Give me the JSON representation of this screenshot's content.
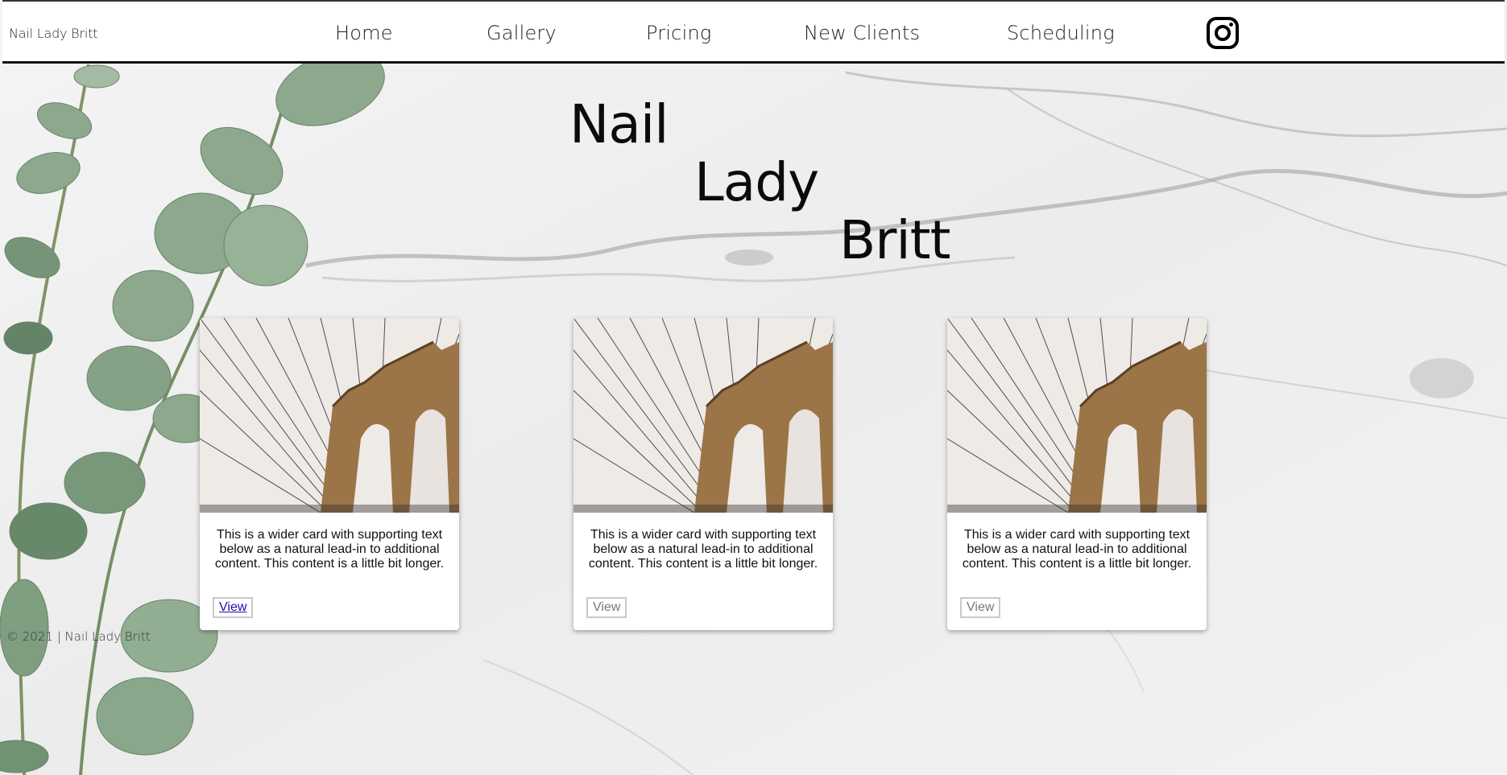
{
  "header": {
    "brand": "Nail Lady Britt",
    "nav": [
      "Home",
      "Gallery",
      "Pricing",
      "New Clients",
      "Scheduling"
    ],
    "social_icon": "instagram-icon"
  },
  "hero": {
    "words": [
      "Nail",
      "Lady",
      "Britt"
    ]
  },
  "cards": [
    {
      "text": "This is a wider card with supporting text below as a natural lead-in to additional content. This content is a little bit longer.",
      "button": "View",
      "image": "bridge-photo"
    },
    {
      "text": "This is a wider card with supporting text below as a natural lead-in to additional content. This content is a little bit longer.",
      "button": "View",
      "image": "bridge-photo"
    },
    {
      "text": "This is a wider card with supporting text below as a natural lead-in to additional content. This content is a little bit longer.",
      "button": "View",
      "image": "bridge-photo"
    }
  ],
  "footer": {
    "copyright": "© 2021 | Nail Lady Britt"
  },
  "colors": {
    "header_bg": "#ffffff",
    "marble": "#efefef",
    "leaf": "#7a9a7b",
    "link": "#1a0dab"
  }
}
